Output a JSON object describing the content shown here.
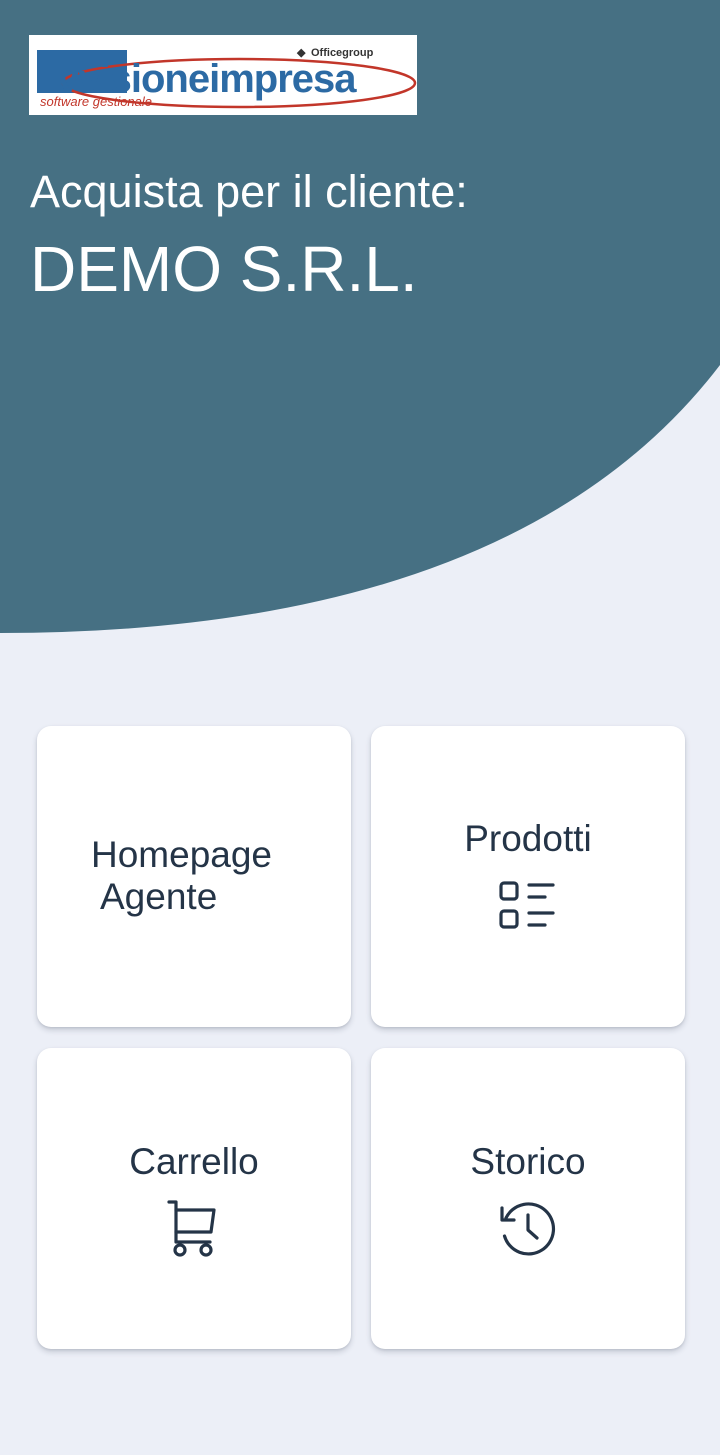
{
  "header": {
    "logo": {
      "brand_text": "vvisioneimpresa",
      "tagline": "software gestionale",
      "group": "Officegroup"
    },
    "buy_label": "Acquista per il cliente:",
    "customer_name": "DEMO S.R.L."
  },
  "menu": {
    "homepage": {
      "line1": "Homepage",
      "line2": "Agente"
    },
    "products": {
      "label": "Prodotti",
      "icon": "list-icon"
    },
    "cart": {
      "label": "Carrello",
      "icon": "cart-icon"
    },
    "history": {
      "label": "Storico",
      "icon": "history-icon"
    }
  },
  "colors": {
    "header_background": "#467083",
    "page_background": "#eceff7",
    "tile_background": "#ffffff",
    "text_dark": "#243447",
    "logo_blue": "#2c6aa4",
    "logo_red": "#c2362a"
  }
}
